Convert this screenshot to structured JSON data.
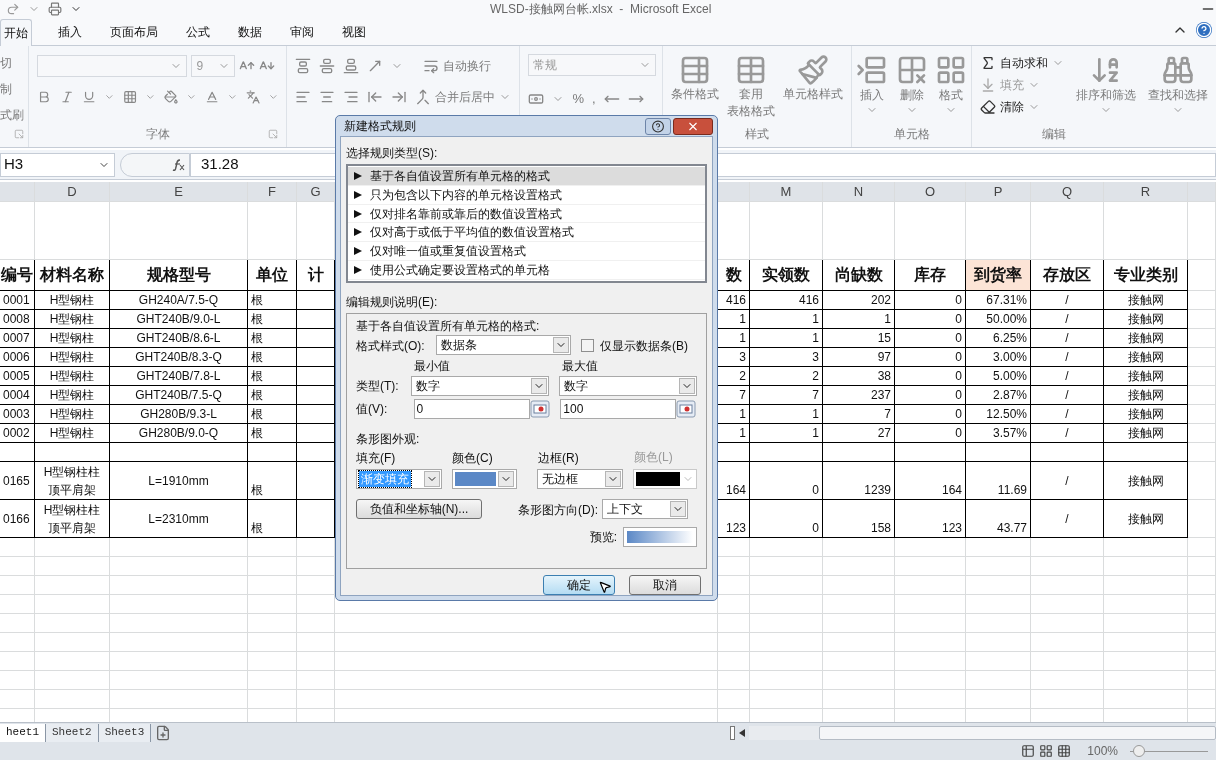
{
  "window": {
    "title": "WLSD-接触网台帐.xlsx  -  Microsoft Excel"
  },
  "ribbon": {
    "tabs": [
      {
        "label": "开始",
        "selected": true
      },
      {
        "label": "插入",
        "selected": false
      },
      {
        "label": "页面布局",
        "selected": false
      },
      {
        "label": "公式",
        "selected": false
      },
      {
        "label": "数据",
        "selected": false
      },
      {
        "label": "审阅",
        "selected": false
      },
      {
        "label": "视图",
        "selected": false
      }
    ],
    "clipboard": {
      "items": [
        "切",
        "制",
        "式刷"
      ]
    },
    "font": {
      "size": "9",
      "label": "字体"
    },
    "alignment": {
      "wrap_text": "自动换行",
      "merge_center": "合并后居中"
    },
    "number": {
      "format": "常规",
      "symbols": [
        "%",
        ","
      ]
    },
    "styles": {
      "buttons": [
        {
          "lines": [
            "条件格式"
          ]
        },
        {
          "lines": [
            "套用",
            "表格格式"
          ]
        },
        {
          "lines": [
            "单元格样式"
          ]
        }
      ],
      "label": "样式"
    },
    "cells": {
      "buttons": [
        "插入",
        "删除",
        "格式"
      ],
      "label": "单元格"
    },
    "editing": {
      "small_buttons": [
        {
          "label": "自动求和",
          "disabled": false
        },
        {
          "label": "填充",
          "disabled": true
        },
        {
          "label": "清除",
          "disabled": false
        }
      ],
      "large_buttons": [
        "排序和筛选",
        "查找和选择"
      ],
      "label": "编辑"
    }
  },
  "formula_bar": {
    "name_box": "H3",
    "formula": "31.28"
  },
  "sheet": {
    "column_letters": [
      "D",
      "E",
      "F",
      "G",
      "M",
      "N",
      "O",
      "P",
      "Q",
      "R"
    ],
    "header": [
      {
        "label": "编号",
        "highlighted": false
      },
      {
        "label": "材料名称",
        "highlighted": false
      },
      {
        "label": "规格型号",
        "highlighted": false
      },
      {
        "label": "单位",
        "highlighted": false
      },
      {
        "label": "计",
        "highlighted": false
      },
      {
        "label": "数",
        "highlighted": false
      },
      {
        "label": "实领数",
        "highlighted": false
      },
      {
        "label": "尚缺数",
        "highlighted": false
      },
      {
        "label": "库存",
        "highlighted": false
      },
      {
        "label": "到货率",
        "highlighted": true
      },
      {
        "label": "存放区",
        "highlighted": false
      },
      {
        "label": "专业类别",
        "highlighted": false
      }
    ],
    "rows": [
      {
        "kind": "item",
        "cells": [
          "0001",
          "H型钢柱",
          "GH240A/7.5-Q",
          "根",
          "416",
          "416",
          "202",
          "0",
          "67.31%",
          "/",
          "接触网"
        ]
      },
      {
        "kind": "item",
        "cells": [
          "0008",
          "H型钢柱",
          "GHT240B/9.0-L",
          "根",
          "1",
          "1",
          "1",
          "0",
          "50.00%",
          "/",
          "接触网"
        ]
      },
      {
        "kind": "item",
        "cells": [
          "0007",
          "H型钢柱",
          "GHT240B/8.6-L",
          "根",
          "1",
          "1",
          "15",
          "0",
          "6.25%",
          "/",
          "接触网"
        ]
      },
      {
        "kind": "item",
        "cells": [
          "0006",
          "H型钢柱",
          "GHT240B/8.3-Q",
          "根",
          "3",
          "3",
          "97",
          "0",
          "3.00%",
          "/",
          "接触网"
        ]
      },
      {
        "kind": "item",
        "cells": [
          "0005",
          "H型钢柱",
          "GHT240B/7.8-L",
          "根",
          "2",
          "2",
          "38",
          "0",
          "5.00%",
          "/",
          "接触网"
        ]
      },
      {
        "kind": "item",
        "cells": [
          "0004",
          "H型钢柱",
          "GHT240B/7.5-Q",
          "根",
          "7",
          "7",
          "237",
          "0",
          "2.87%",
          "/",
          "接触网"
        ]
      },
      {
        "kind": "item",
        "cells": [
          "0003",
          "H型钢柱",
          "GH280B/9.3-L",
          "根",
          "1",
          "1",
          "7",
          "0",
          "12.50%",
          "/",
          "接触网"
        ]
      },
      {
        "kind": "item",
        "cells": [
          "0002",
          "H型钢柱",
          "GH280B/9.0-Q",
          "根",
          "1",
          "1",
          "27",
          "0",
          "3.57%",
          "/",
          "接触网"
        ]
      },
      {
        "kind": "blank"
      },
      {
        "kind": "tall",
        "cells": [
          "0165",
          [
            "H型钢柱柱",
            "顶平肩架"
          ],
          "L=1910mm",
          "根",
          "164",
          "0",
          "1239",
          "164",
          "11.69",
          "/",
          "接触网"
        ]
      },
      {
        "kind": "tall",
        "cells": [
          "0166",
          [
            "H型钢柱柱",
            "顶平肩架"
          ],
          "L=2310mm",
          "根",
          "123",
          "0",
          "158",
          "123",
          "43.77",
          "/",
          "接触网"
        ]
      }
    ]
  },
  "dialog": {
    "title": "新建格式规则",
    "rule_type_label": "选择规则类型(S):",
    "rule_types": [
      {
        "label": "基于各自值设置所有单元格的格式",
        "selected": true
      },
      {
        "label": "只为包含以下内容的单元格设置格式",
        "selected": false
      },
      {
        "label": "仅对排名靠前或靠后的数值设置格式",
        "selected": false
      },
      {
        "label": "仅对高于或低于平均值的数值设置格式",
        "selected": false
      },
      {
        "label": "仅对唯一值或重复值设置格式",
        "selected": false
      },
      {
        "label": "使用公式确定要设置格式的单元格",
        "selected": false
      }
    ],
    "edit_label": "编辑规则说明(E):",
    "description": "基于各自值设置所有单元格的格式:",
    "format_style": {
      "label": "格式样式(O):",
      "value": "数据条"
    },
    "bar_only": {
      "label": "仅显示数据条(B)",
      "checked": false
    },
    "type_label": "类型(T):",
    "value_label": "值(V):",
    "min": {
      "heading": "最小值",
      "type": "数字",
      "value": "0"
    },
    "max": {
      "heading": "最大值",
      "type": "数字",
      "value": "100"
    },
    "appearance_label": "条形图外观:",
    "fill": {
      "label": "填充(F)",
      "value": "渐变填充",
      "focused": true
    },
    "fill_color": {
      "label": "颜色(C)",
      "color": "#5b88c6"
    },
    "border": {
      "label": "边框(R)",
      "value": "无边框"
    },
    "border_color": {
      "label": "颜色(L)",
      "color": "#000000",
      "disabled": true
    },
    "axis_button": "负值和坐标轴(N)...",
    "direction": {
      "label": "条形图方向(D):",
      "value": "上下文"
    },
    "preview_label": "预览:",
    "buttons": [
      {
        "label": "确定",
        "default": true
      },
      {
        "label": "取消",
        "default": false
      }
    ]
  },
  "sheet_tabs": [
    {
      "label": "heet1",
      "selected": true
    },
    {
      "label": "Sheet2",
      "selected": false
    },
    {
      "label": "Sheet3",
      "selected": false
    }
  ],
  "status_bar": {
    "zoom": "100%",
    "level": 0.05
  }
}
